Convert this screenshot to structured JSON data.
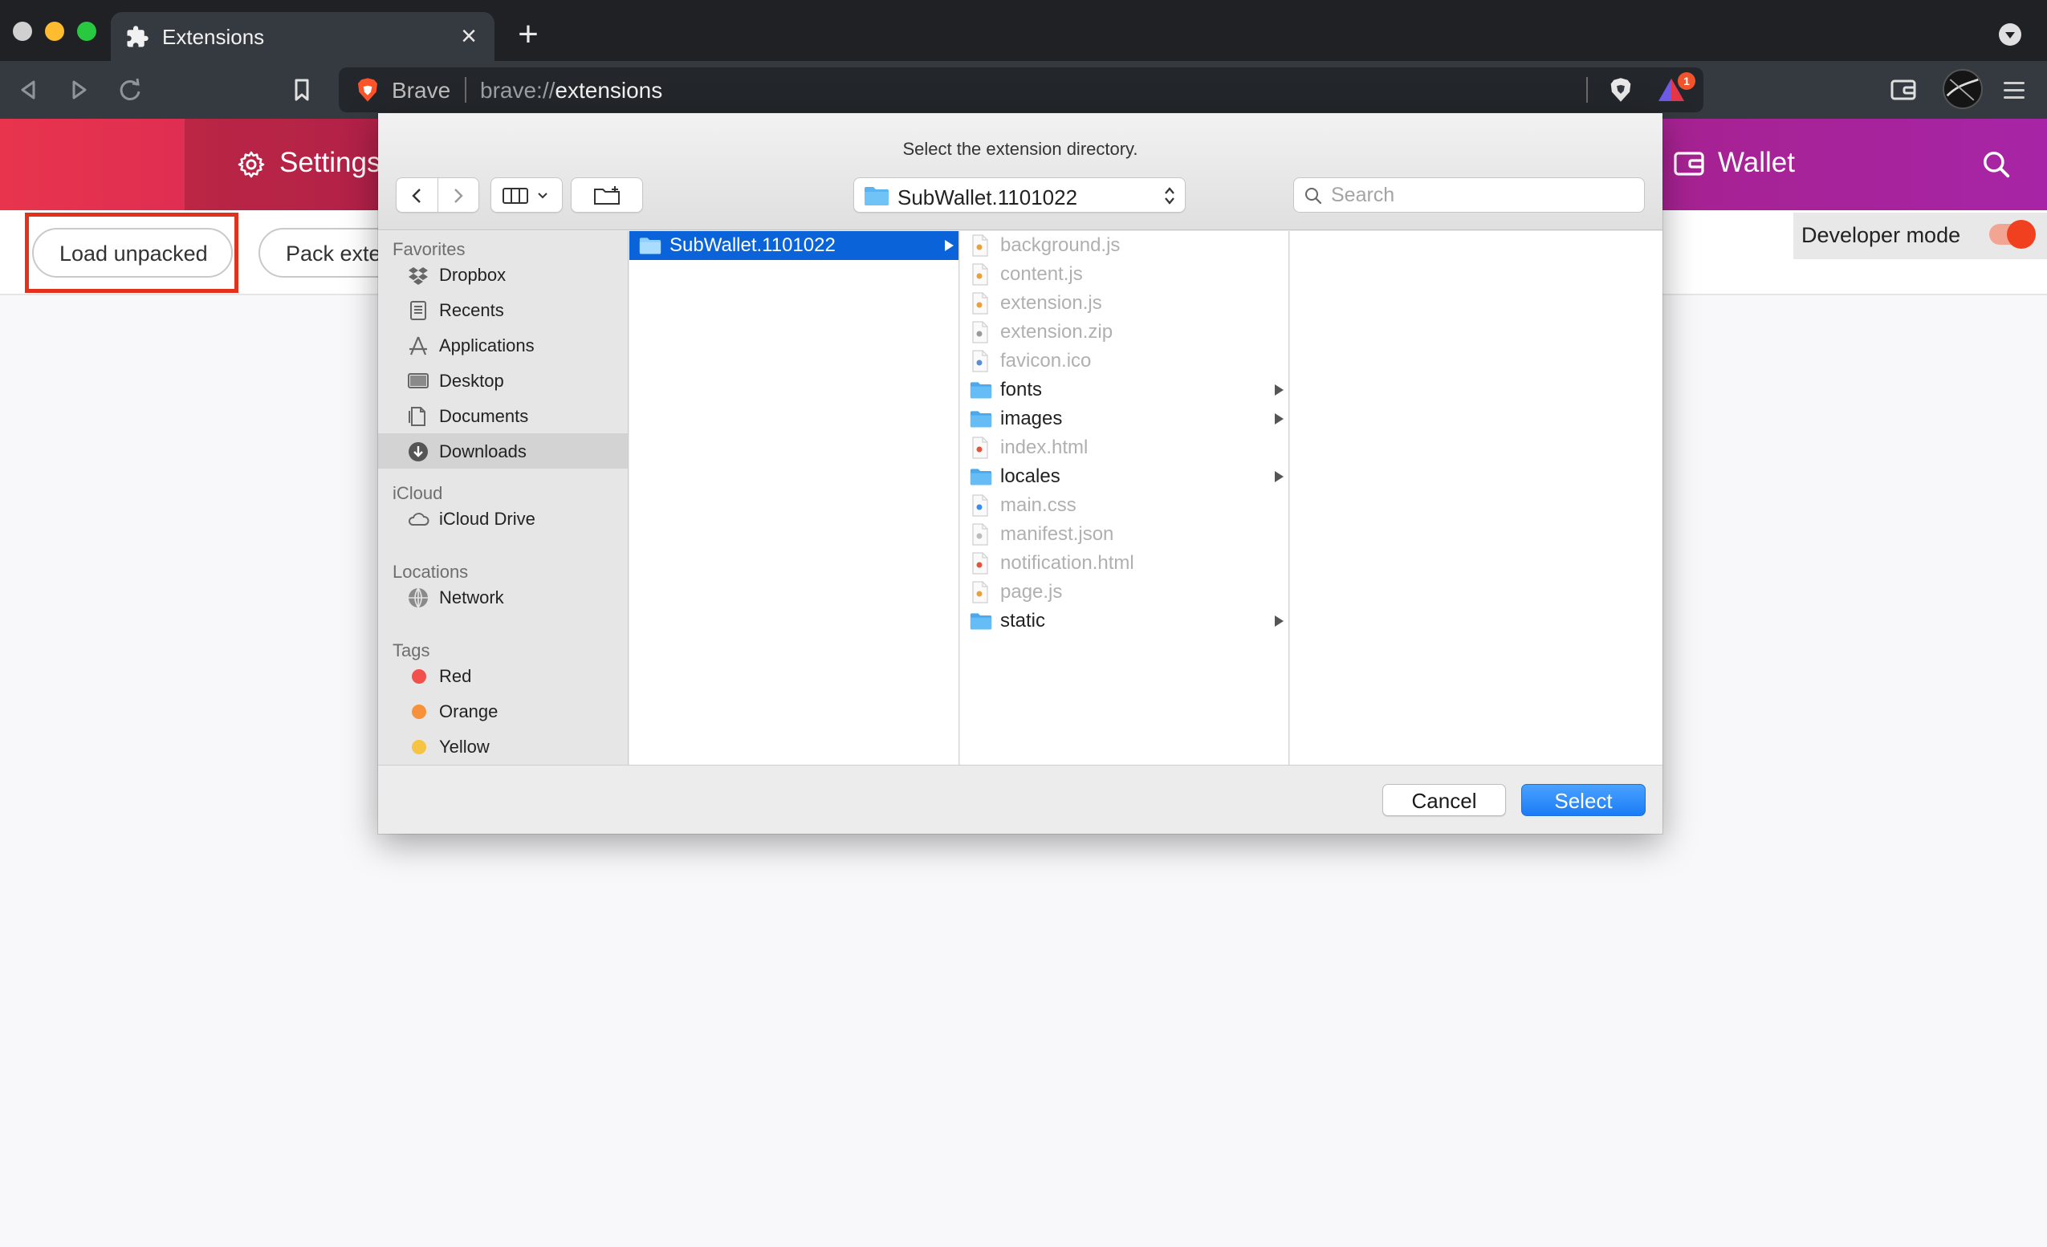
{
  "browser": {
    "tab_title": "Extensions",
    "tab_close": "×",
    "new_tab": "+",
    "omnibox_brand": "Brave",
    "omnibox_scheme": "brave://",
    "omnibox_host": "extensions",
    "rewards_badge": "1"
  },
  "page": {
    "settings_label": "Settings",
    "wallet_label": "Wallet",
    "load_unpacked": "Load unpacked",
    "pack_extension": "Pack exte",
    "developer_mode_label": "Developer mode",
    "developer_mode_on": true
  },
  "dialog": {
    "title": "Select the extension directory.",
    "location": "SubWallet.1101022",
    "search_placeholder": "Search",
    "cancel_label": "Cancel",
    "select_label": "Select",
    "sidebar": {
      "favorites_header": "Favorites",
      "favorites": [
        {
          "label": "Dropbox",
          "icon": "dropbox-icon"
        },
        {
          "label": "Recents",
          "icon": "recents-icon"
        },
        {
          "label": "Applications",
          "icon": "applications-icon"
        },
        {
          "label": "Desktop",
          "icon": "desktop-icon"
        },
        {
          "label": "Documents",
          "icon": "documents-icon"
        },
        {
          "label": "Downloads",
          "icon": "downloads-icon",
          "selected": true
        }
      ],
      "icloud_header": "iCloud",
      "icloud": [
        {
          "label": "iCloud Drive",
          "icon": "icloud-icon"
        }
      ],
      "locations_header": "Locations",
      "locations": [
        {
          "label": "Network",
          "icon": "network-icon"
        }
      ],
      "tags_header": "Tags",
      "tags": [
        {
          "label": "Red",
          "color": "#f2504b"
        },
        {
          "label": "Orange",
          "color": "#f7923a"
        },
        {
          "label": "Yellow",
          "color": "#f6c442"
        }
      ]
    },
    "column1": [
      {
        "name": "SubWallet.1101022",
        "kind": "folder",
        "selected": true
      }
    ],
    "column2": [
      {
        "name": "background.js",
        "kind": "js"
      },
      {
        "name": "content.js",
        "kind": "js"
      },
      {
        "name": "extension.js",
        "kind": "js"
      },
      {
        "name": "extension.zip",
        "kind": "zip"
      },
      {
        "name": "favicon.ico",
        "kind": "ico"
      },
      {
        "name": "fonts",
        "kind": "folder"
      },
      {
        "name": "images",
        "kind": "folder"
      },
      {
        "name": "index.html",
        "kind": "html"
      },
      {
        "name": "locales",
        "kind": "folder"
      },
      {
        "name": "main.css",
        "kind": "css"
      },
      {
        "name": "manifest.json",
        "kind": "json"
      },
      {
        "name": "notification.html",
        "kind": "html"
      },
      {
        "name": "page.js",
        "kind": "js"
      },
      {
        "name": "static",
        "kind": "folder"
      }
    ]
  },
  "colors": {
    "accent_blue": "#0a63d8",
    "highlight_red": "#e2311d",
    "header_start": "#e8344d",
    "header_end": "#a724a6"
  }
}
